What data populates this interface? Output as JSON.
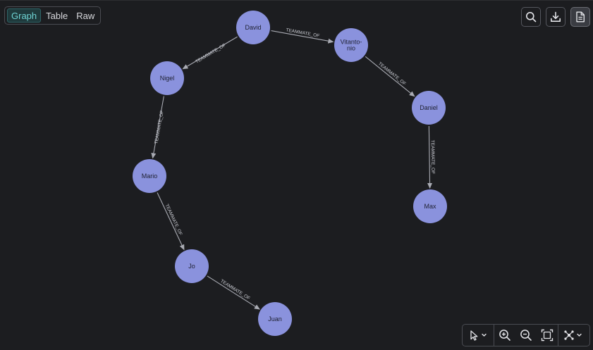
{
  "view_switch": {
    "tabs": [
      {
        "label": "Graph",
        "active": true
      },
      {
        "label": "Table",
        "active": false
      },
      {
        "label": "Raw",
        "active": false
      }
    ]
  },
  "top_tools": {
    "icons": [
      "search-icon",
      "download-icon",
      "document-icon"
    ]
  },
  "graph": {
    "node_color": "#8a92dd",
    "nodes": [
      {
        "id": "david",
        "label": "David"
      },
      {
        "id": "vitantonio",
        "label_lines": [
          "Vitanto-",
          "nio"
        ]
      },
      {
        "id": "nigel",
        "label": "Nigel"
      },
      {
        "id": "daniel",
        "label": "Daniel"
      },
      {
        "id": "mario",
        "label": "Mario"
      },
      {
        "id": "max",
        "label": "Max"
      },
      {
        "id": "jo",
        "label": "Jo"
      },
      {
        "id": "juan",
        "label": "Juan"
      }
    ],
    "edges": [
      {
        "from": "david",
        "to": "vitantonio",
        "label": "TEAMMATE_OF"
      },
      {
        "from": "david",
        "to": "nigel",
        "label": "TEAMMATE_OF"
      },
      {
        "from": "vitantonio",
        "to": "daniel",
        "label": "TEAMMATE_OF"
      },
      {
        "from": "nigel",
        "to": "mario",
        "label": "TEAMMATE_OF"
      },
      {
        "from": "daniel",
        "to": "max",
        "label": "TEAMMATE_OF"
      },
      {
        "from": "mario",
        "to": "jo",
        "label": "TEAMMATE_OF"
      },
      {
        "from": "jo",
        "to": "juan",
        "label": "TEAMMATE_OF"
      }
    ]
  },
  "bottom_bar": {
    "icons": [
      "pointer-icon",
      "zoom-in-icon",
      "zoom-out-icon",
      "fit-view-icon",
      "layout-icon"
    ]
  }
}
